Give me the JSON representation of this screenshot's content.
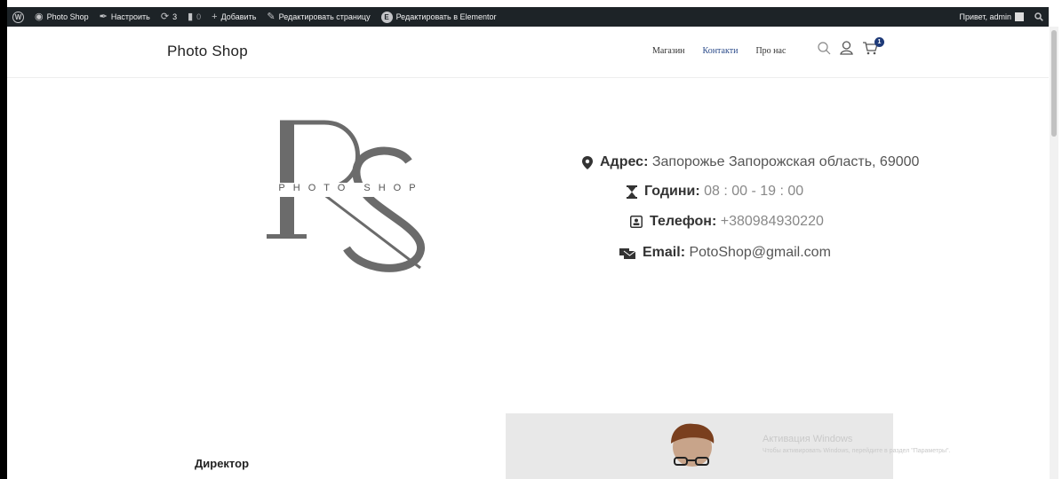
{
  "adminbar": {
    "items": [
      {
        "label": "Photo Shop",
        "icon": "dashboard-icon"
      },
      {
        "label": "Настроить",
        "icon": "brush-icon"
      },
      {
        "label": "3",
        "icon": "updates-icon"
      },
      {
        "label": "0",
        "icon": "comments-icon"
      },
      {
        "label": "Добавить",
        "icon": "plus-icon"
      },
      {
        "label": "Редактировать страницу",
        "icon": "pencil-icon"
      },
      {
        "label": "Редактировать в Elementor",
        "icon": "elementor-icon"
      }
    ],
    "greeting": "Привет, admin"
  },
  "header": {
    "site_title": "Photo Shop",
    "nav": [
      {
        "label": "Магазин",
        "active": false
      },
      {
        "label": "Контакти",
        "active": true
      },
      {
        "label": "Про нас",
        "active": false
      }
    ],
    "cart_count": "1"
  },
  "logo": {
    "monogram": "RS",
    "tagline": "PHOTO SHOP"
  },
  "contact": {
    "address_label": "Адрес:",
    "address_value": "Запорожье Запорожская область, 69000",
    "hours_label": "Години:",
    "hours_value": "08 : 00 - 19 : 00",
    "phone_label": "Телефон:",
    "phone_value": "+380984930220",
    "email_label": "Email:",
    "email_value": "PotoShop@gmail.com"
  },
  "team": {
    "director_label": "Директор"
  },
  "windows_activation": {
    "title": "Активация Windows",
    "subtitle": "Чтобы активировать Windows, перейдите в раздел \"Параметры\"."
  },
  "colors": {
    "adminbar_bg": "#1d2327",
    "accent": "#1e3a78",
    "logo_gray": "#6b6b6b"
  }
}
